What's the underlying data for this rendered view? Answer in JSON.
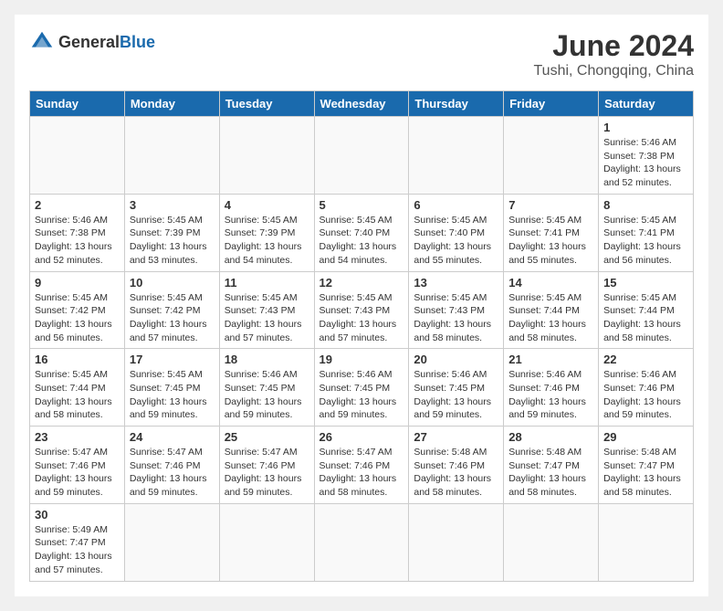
{
  "header": {
    "logo_general": "General",
    "logo_blue": "Blue",
    "title": "June 2024",
    "subtitle": "Tushi, Chongqing, China"
  },
  "weekdays": [
    "Sunday",
    "Monday",
    "Tuesday",
    "Wednesday",
    "Thursday",
    "Friday",
    "Saturday"
  ],
  "weeks": [
    [
      {
        "day": "",
        "info": ""
      },
      {
        "day": "",
        "info": ""
      },
      {
        "day": "",
        "info": ""
      },
      {
        "day": "",
        "info": ""
      },
      {
        "day": "",
        "info": ""
      },
      {
        "day": "",
        "info": ""
      },
      {
        "day": "1",
        "info": "Sunrise: 5:46 AM\nSunset: 7:38 PM\nDaylight: 13 hours and 52 minutes."
      }
    ],
    [
      {
        "day": "2",
        "info": "Sunrise: 5:46 AM\nSunset: 7:38 PM\nDaylight: 13 hours and 52 minutes."
      },
      {
        "day": "3",
        "info": "Sunrise: 5:45 AM\nSunset: 7:39 PM\nDaylight: 13 hours and 53 minutes."
      },
      {
        "day": "4",
        "info": "Sunrise: 5:45 AM\nSunset: 7:39 PM\nDaylight: 13 hours and 54 minutes."
      },
      {
        "day": "5",
        "info": "Sunrise: 5:45 AM\nSunset: 7:40 PM\nDaylight: 13 hours and 54 minutes."
      },
      {
        "day": "6",
        "info": "Sunrise: 5:45 AM\nSunset: 7:40 PM\nDaylight: 13 hours and 55 minutes."
      },
      {
        "day": "7",
        "info": "Sunrise: 5:45 AM\nSunset: 7:41 PM\nDaylight: 13 hours and 55 minutes."
      },
      {
        "day": "8",
        "info": "Sunrise: 5:45 AM\nSunset: 7:41 PM\nDaylight: 13 hours and 56 minutes."
      }
    ],
    [
      {
        "day": "9",
        "info": "Sunrise: 5:45 AM\nSunset: 7:42 PM\nDaylight: 13 hours and 56 minutes."
      },
      {
        "day": "10",
        "info": "Sunrise: 5:45 AM\nSunset: 7:42 PM\nDaylight: 13 hours and 57 minutes."
      },
      {
        "day": "11",
        "info": "Sunrise: 5:45 AM\nSunset: 7:43 PM\nDaylight: 13 hours and 57 minutes."
      },
      {
        "day": "12",
        "info": "Sunrise: 5:45 AM\nSunset: 7:43 PM\nDaylight: 13 hours and 57 minutes."
      },
      {
        "day": "13",
        "info": "Sunrise: 5:45 AM\nSunset: 7:43 PM\nDaylight: 13 hours and 58 minutes."
      },
      {
        "day": "14",
        "info": "Sunrise: 5:45 AM\nSunset: 7:44 PM\nDaylight: 13 hours and 58 minutes."
      },
      {
        "day": "15",
        "info": "Sunrise: 5:45 AM\nSunset: 7:44 PM\nDaylight: 13 hours and 58 minutes."
      }
    ],
    [
      {
        "day": "16",
        "info": "Sunrise: 5:45 AM\nSunset: 7:44 PM\nDaylight: 13 hours and 58 minutes."
      },
      {
        "day": "17",
        "info": "Sunrise: 5:45 AM\nSunset: 7:45 PM\nDaylight: 13 hours and 59 minutes."
      },
      {
        "day": "18",
        "info": "Sunrise: 5:46 AM\nSunset: 7:45 PM\nDaylight: 13 hours and 59 minutes."
      },
      {
        "day": "19",
        "info": "Sunrise: 5:46 AM\nSunset: 7:45 PM\nDaylight: 13 hours and 59 minutes."
      },
      {
        "day": "20",
        "info": "Sunrise: 5:46 AM\nSunset: 7:45 PM\nDaylight: 13 hours and 59 minutes."
      },
      {
        "day": "21",
        "info": "Sunrise: 5:46 AM\nSunset: 7:46 PM\nDaylight: 13 hours and 59 minutes."
      },
      {
        "day": "22",
        "info": "Sunrise: 5:46 AM\nSunset: 7:46 PM\nDaylight: 13 hours and 59 minutes."
      }
    ],
    [
      {
        "day": "23",
        "info": "Sunrise: 5:47 AM\nSunset: 7:46 PM\nDaylight: 13 hours and 59 minutes."
      },
      {
        "day": "24",
        "info": "Sunrise: 5:47 AM\nSunset: 7:46 PM\nDaylight: 13 hours and 59 minutes."
      },
      {
        "day": "25",
        "info": "Sunrise: 5:47 AM\nSunset: 7:46 PM\nDaylight: 13 hours and 59 minutes."
      },
      {
        "day": "26",
        "info": "Sunrise: 5:47 AM\nSunset: 7:46 PM\nDaylight: 13 hours and 58 minutes."
      },
      {
        "day": "27",
        "info": "Sunrise: 5:48 AM\nSunset: 7:46 PM\nDaylight: 13 hours and 58 minutes."
      },
      {
        "day": "28",
        "info": "Sunrise: 5:48 AM\nSunset: 7:47 PM\nDaylight: 13 hours and 58 minutes."
      },
      {
        "day": "29",
        "info": "Sunrise: 5:48 AM\nSunset: 7:47 PM\nDaylight: 13 hours and 58 minutes."
      }
    ],
    [
      {
        "day": "30",
        "info": "Sunrise: 5:49 AM\nSunset: 7:47 PM\nDaylight: 13 hours and 57 minutes."
      },
      {
        "day": "",
        "info": ""
      },
      {
        "day": "",
        "info": ""
      },
      {
        "day": "",
        "info": ""
      },
      {
        "day": "",
        "info": ""
      },
      {
        "day": "",
        "info": ""
      },
      {
        "day": "",
        "info": ""
      }
    ]
  ]
}
